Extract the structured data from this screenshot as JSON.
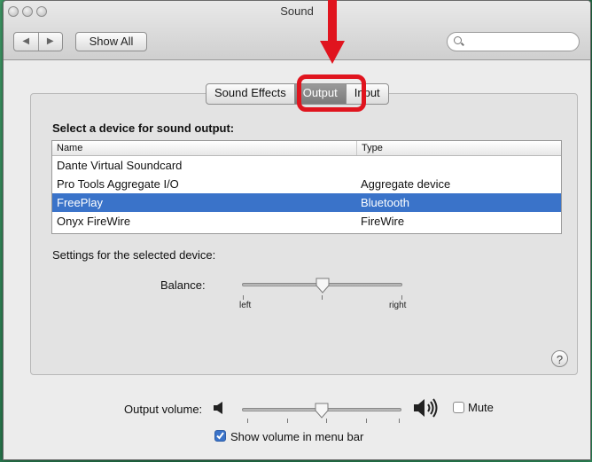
{
  "window": {
    "title": "Sound"
  },
  "toolbar": {
    "back": "◀",
    "forward": "▶",
    "show_all": "Show All",
    "search_placeholder": ""
  },
  "tabs": [
    {
      "label": "Sound Effects",
      "active": false
    },
    {
      "label": "Output",
      "active": true
    },
    {
      "label": "Input",
      "active": false
    }
  ],
  "output": {
    "section_title": "Select a device for sound output:",
    "columns": [
      "Name",
      "Type"
    ],
    "devices": [
      {
        "name": "Dante Virtual Soundcard",
        "type": "",
        "selected": false
      },
      {
        "name": "Pro Tools Aggregate I/O",
        "type": "Aggregate device",
        "selected": false
      },
      {
        "name": "FreePlay",
        "type": "Bluetooth",
        "selected": true
      },
      {
        "name": "Onyx FireWire",
        "type": "FireWire",
        "selected": false
      }
    ],
    "settings_label": "Settings for the selected device:",
    "balance": {
      "label": "Balance:",
      "left": "left",
      "right": "right",
      "value": 0.5
    }
  },
  "volume": {
    "label": "Output volume:",
    "value": 0.5,
    "mute_label": "Mute",
    "mute_checked": false,
    "show_in_menu_bar_label": "Show volume in menu bar",
    "show_in_menu_bar_checked": true
  },
  "help": {
    "label": "?"
  },
  "colors": {
    "selection": "#3a73c9",
    "annotation": "#e0141e"
  }
}
